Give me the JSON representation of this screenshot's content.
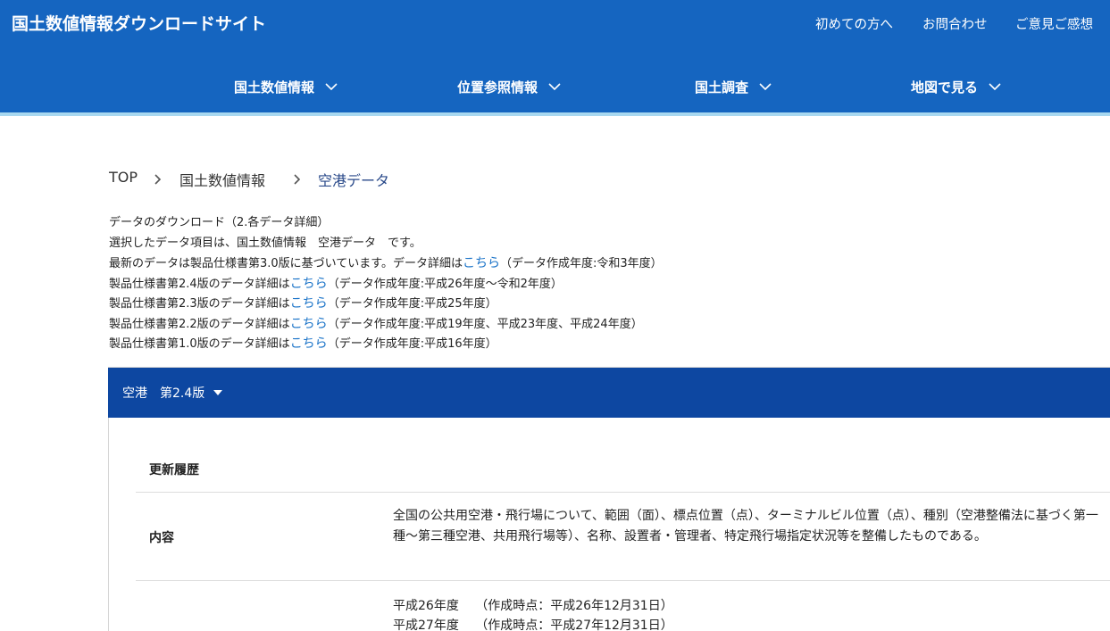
{
  "header": {
    "site_title": "国土数値情報ダウンロードサイト",
    "links": [
      "初めての方へ",
      "お問合わせ",
      "ご意見ご感想"
    ],
    "nav": [
      "国土数値情報",
      "位置参照情報",
      "国土調査",
      "地図で見る"
    ],
    "colors": {
      "bar": "#1565c0",
      "underline": "#a8d8f0"
    }
  },
  "breadcrumb": {
    "items": [
      "TOP",
      "国土数値情報",
      "空港データ"
    ]
  },
  "info": {
    "line1": "データのダウンロード（2.各データ詳細）",
    "line2": "選択したデータ項目は、国土数値情報　空港データ　です。",
    "line3_pre": "最新のデータは製品仕様書第3.0版に基づいています。データ詳細は",
    "line3_link": "こちら",
    "line3_post": "（データ作成年度:令和3年度）",
    "line4_pre": "製品仕様書第2.4版のデータ詳細は",
    "line4_link": "こちら",
    "line4_post": "（データ作成年度:平成26年度～令和2年度）",
    "line5_pre": "製品仕様書第2.3版のデータ詳細は",
    "line5_link": "こちら",
    "line5_post": "（データ作成年度:平成25年度）",
    "line6_pre": "製品仕様書第2.2版のデータ詳細は",
    "line6_link": "こちら",
    "line6_post": "（データ作成年度:平成19年度、平成23年度、平成24年度）",
    "line7_pre": "製品仕様書第1.0版のデータ詳細は",
    "line7_link": "こちら",
    "line7_post": "（データ作成年度:平成16年度）"
  },
  "panel": {
    "title": "空港　第2.4版",
    "color": "#0d47a1",
    "history_label": "更新履歴",
    "content_label": "内容",
    "content_text": "全国の公共用空港・飛行場について、範囲（面）、標点位置（点）、ターミナルビル位置（点）、種別（空港整備法に基づく第一種～第三種空港、共用飛行場等）、名称、設置者・管理者、特定飛行場指定状況等を整備したものである。",
    "history_lines": [
      "平成26年度　 （作成時点：平成26年12月31日）",
      "平成27年度　 （作成時点：平成27年12月31日）"
    ]
  }
}
